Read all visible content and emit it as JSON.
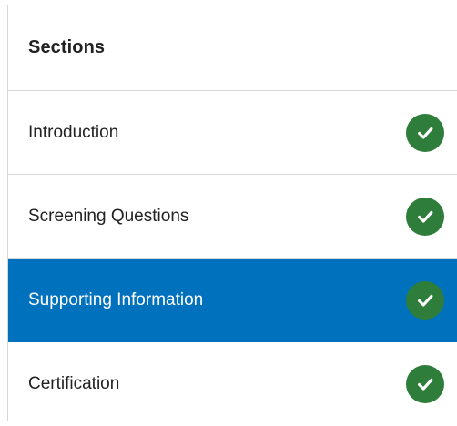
{
  "sections": {
    "title": "Sections",
    "items": [
      {
        "label": "Introduction",
        "status": "complete",
        "active": false
      },
      {
        "label": "Screening Questions",
        "status": "complete",
        "active": false
      },
      {
        "label": "Supporting Information",
        "status": "complete",
        "active": true
      },
      {
        "label": "Certification",
        "status": "complete",
        "active": false
      }
    ]
  },
  "colors": {
    "active_background": "#0071bc",
    "check_complete": "#2e7d3a",
    "divider": "#d6d6d6"
  },
  "icons": {
    "status_complete": "check-circle-icon"
  }
}
